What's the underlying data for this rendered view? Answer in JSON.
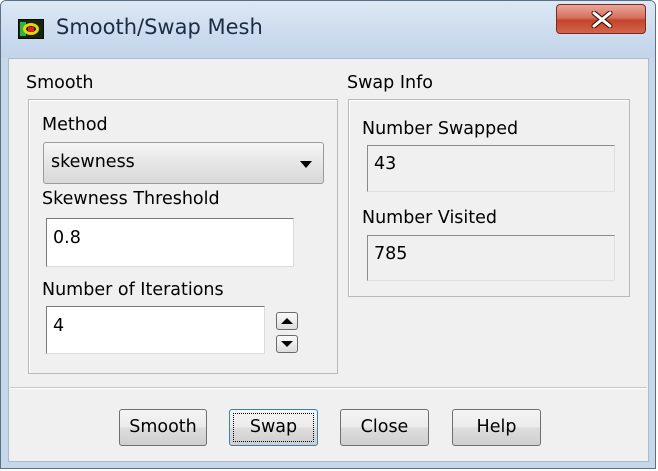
{
  "window": {
    "title": "Smooth/Swap Mesh",
    "close_glyph": "x",
    "app_icon": "fluent-app-icon",
    "close_button_color": "#c7452c"
  },
  "smooth": {
    "group_label": "Smooth",
    "method_label": "Method",
    "method_value": "skewness",
    "skewness_label": "Skewness Threshold",
    "skewness_value": "0.8",
    "iterations_label": "Number of Iterations",
    "iterations_value": "4"
  },
  "swap_info": {
    "group_label": "Swap Info",
    "swapped_label": "Number Swapped",
    "swapped_value": "43",
    "visited_label": "Number Visited",
    "visited_value": "785"
  },
  "buttons": {
    "smooth": "Smooth",
    "swap": "Swap",
    "close": "Close",
    "help": "Help"
  }
}
